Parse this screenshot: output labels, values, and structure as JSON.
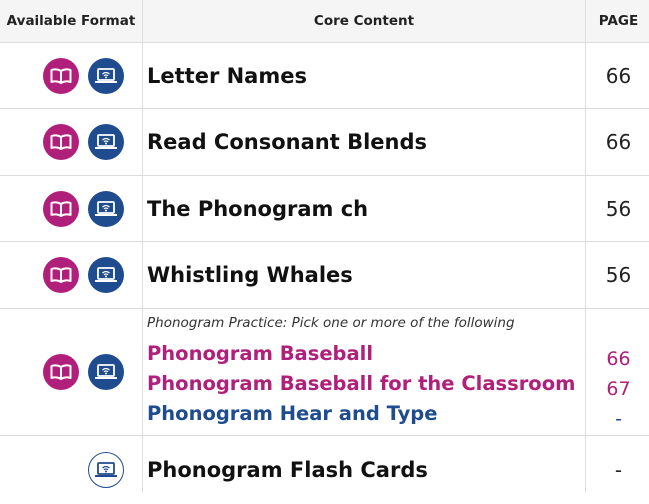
{
  "header": {
    "format": "Available Format",
    "core": "Core Content",
    "page": "PAGE"
  },
  "colors": {
    "book": "#b0207a",
    "digital": "#1f4b8f"
  },
  "rows": [
    {
      "formats": [
        "book-icon",
        "laptop-wifi-icon"
      ],
      "title": "Letter Names",
      "page": "66"
    },
    {
      "formats": [
        "book-icon",
        "laptop-wifi-icon"
      ],
      "title": "Read Consonant Blends",
      "page": "66"
    },
    {
      "formats": [
        "book-icon",
        "laptop-wifi-icon"
      ],
      "title": "The Phonogram ch",
      "page": "56"
    },
    {
      "formats": [
        "book-icon",
        "laptop-wifi-icon"
      ],
      "title": "Whistling Whales",
      "page": "56"
    },
    {
      "formats": [
        "book-icon",
        "laptop-wifi-icon"
      ],
      "intro": "Phonogram Practice: Pick one or more of the following",
      "options": [
        {
          "title": "Phonogram Baseball",
          "page": "66",
          "color": "#b0207a"
        },
        {
          "title": "Phonogram Baseball for the Classroom",
          "page": "67",
          "color": "#b0207a"
        },
        {
          "title": "Phonogram Hear and Type",
          "page": "-",
          "color": "#1f4b8f"
        }
      ]
    },
    {
      "formats": [
        "laptop-wifi-outline-icon"
      ],
      "title": "Phonogram Flash Cards",
      "page": "-"
    }
  ]
}
